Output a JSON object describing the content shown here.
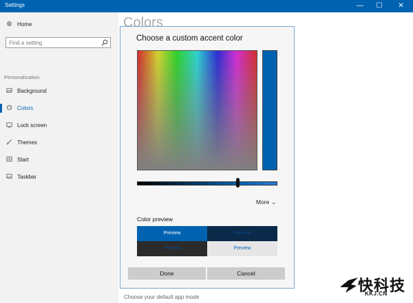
{
  "window": {
    "title": "Settings",
    "minimize_glyph": "—",
    "maximize_glyph": "☐",
    "close_glyph": "✕"
  },
  "sidebar": {
    "home": {
      "label": "Home",
      "icon": "gear-icon"
    },
    "search": {
      "placeholder": "Find a setting",
      "icon": "search-icon"
    },
    "section": "Personalization",
    "items": [
      {
        "label": "Background",
        "icon": "image-icon"
      },
      {
        "label": "Colors",
        "icon": "palette-icon",
        "selected": true
      },
      {
        "label": "Lock screen",
        "icon": "lock-screen-icon"
      },
      {
        "label": "Themes",
        "icon": "brush-icon"
      },
      {
        "label": "Start",
        "icon": "start-grid-icon"
      },
      {
        "label": "Taskbar",
        "icon": "taskbar-icon"
      }
    ]
  },
  "main": {
    "title": "Colors",
    "bottom_link": "Choose your default app mode"
  },
  "dialog": {
    "title": "Choose a custom accent color",
    "selected_color": "#0063b1",
    "slider_level": 0.72,
    "more_label": "More",
    "preview_label": "Color preview",
    "previews": [
      "Preview",
      "Preview",
      "Preview",
      "Preview"
    ],
    "done_label": "Done",
    "cancel_label": "Cancel"
  },
  "watermark": {
    "text": "快科技",
    "domain": "KKJ.CN"
  },
  "colors": {
    "accent": "#0063b1",
    "sidebar_bg": "#f2f2f2",
    "dialog_bg": "#f6f6f6"
  }
}
